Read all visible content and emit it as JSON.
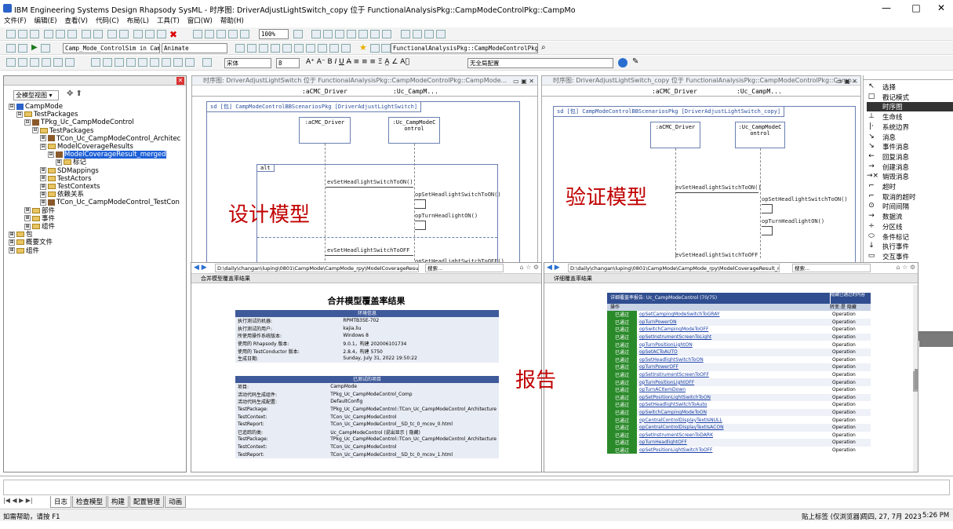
{
  "window": {
    "title": "IBM Engineering Systems Design Rhapsody SysML - 时序图: DriverAdjustLightSwitch_copy 位于 FunctionalAnalysisPkg::CampModeControlPkg::CampMo",
    "minimize": "—",
    "maximize": "□",
    "close": "✕"
  },
  "menu": [
    "文件(F)",
    "编辑(E)",
    "查看(V)",
    "代码(C)",
    "布局(L)",
    "工具(T)",
    "窗口(W)",
    "帮助(H)"
  ],
  "toolbar": {
    "zoom": "100%",
    "sim_config": "Camp_Mode_ControlSim in CampM",
    "animate": "Animate",
    "package_path": "FunctionalAnalysisPkg::CampModeControlPkg::Cam",
    "font": "宋体",
    "font_size": "8",
    "format_set": "无全局配置"
  },
  "left_panel": {
    "view_selector": "全模型视图",
    "tree": [
      {
        "level": 0,
        "expander": "⊟",
        "icon": "model",
        "label": "CampMode"
      },
      {
        "level": 1,
        "expander": "⊟",
        "icon": "folder",
        "label": "TestPackages"
      },
      {
        "level": 2,
        "expander": "⊟",
        "icon": "pkg",
        "label": "TPkg_Uc_CampModeControl"
      },
      {
        "level": 3,
        "expander": "⊟",
        "icon": "folder",
        "label": "TestPackages"
      },
      {
        "level": 4,
        "expander": "⊞",
        "icon": "pkg",
        "label": "TCon_Uc_CampModeControl_Architec"
      },
      {
        "level": 4,
        "expander": "⊟",
        "icon": "folder",
        "label": "ModelCoverageResults"
      },
      {
        "level": 5,
        "expander": "⊟",
        "icon": "pkg",
        "label": "ModelCoverageResult_merged",
        "selected": true
      },
      {
        "level": 6,
        "expander": "⊞",
        "icon": "folder",
        "label": "标记"
      },
      {
        "level": 4,
        "expander": "⊞",
        "icon": "folder",
        "label": "SDMappings"
      },
      {
        "level": 4,
        "expander": "⊞",
        "icon": "folder",
        "label": "TestActors"
      },
      {
        "level": 4,
        "expander": "⊞",
        "icon": "folder",
        "label": "TestContexts"
      },
      {
        "level": 4,
        "expander": "⊞",
        "icon": "folder",
        "label": "依赖关系"
      },
      {
        "level": 4,
        "expander": "⊞",
        "icon": "pkg",
        "label": "TCon_Uc_CampModeControl_TestCon"
      },
      {
        "level": 2,
        "expander": "⊞",
        "icon": "folder",
        "label": "部件"
      },
      {
        "level": 2,
        "expander": "⊞",
        "icon": "folder",
        "label": "事件"
      },
      {
        "level": 2,
        "expander": "⊞",
        "icon": "folder",
        "label": "组件"
      },
      {
        "level": 0,
        "expander": "⊞",
        "icon": "folder",
        "label": "包"
      },
      {
        "level": 0,
        "expander": "⊞",
        "icon": "folder",
        "label": "概要文件"
      },
      {
        "level": 0,
        "expander": "⊞",
        "icon": "folder",
        "label": "组件"
      }
    ]
  },
  "design_window": {
    "title": "时序图: DriverAdjustLightSwitch 位于 FunctionalAnalysisPkg::CampModeControlPkg::CampMode...",
    "lifeline_headers": [
      ":aCMC_Driver",
      ":Uc_CampM..."
    ],
    "frame_label": "sd [包] CampModeControlBBScenariosPkg [DriverAdjustLightSwitch]",
    "lifelines": [
      ":aCMC_Driver",
      ":Uc_CampModeC\nontrol"
    ],
    "alt_label": "alt",
    "messages": [
      "evSetHeadlightSwitchToON()",
      "opSetHeadlightSwitchToON()",
      "opTurnHeadlightON()",
      "evSetHeadlightSwitchToOFF",
      "opSetHeadlightSwitchToOFF()"
    ],
    "overlay": "设计模型"
  },
  "verify_window": {
    "title": "时序图: DriverAdjustLightSwitch_copy 位于 FunctionalAnalysisPkg::CampModeControlPkg::Camp...",
    "lifeline_headers": [
      ":aCMC_Driver",
      ":Uc_CampM..."
    ],
    "frame_label": "sd [包] CampModeControlBBScenariosPkg [DriverAdjustLightSwitch_copy]",
    "lifelines": [
      ":aCMC_Driver",
      ":Uc_CampModeC\nontrol"
    ],
    "messages": [
      "evSetHeadlightSwitchToON()",
      "opSetHeadlightSwitchToON()",
      "opTurnHeadlightON()",
      "evSetHeadlightSwitchToOFF"
    ],
    "overlay": "验证模型"
  },
  "report_overlay": "报告",
  "report_left": {
    "address": "D:\\daily\\changan\\luping\\0801\\CampMode\\CampMode_rpy\\ModelCoverageResult_merge",
    "search": "搜索...",
    "tab": "合并模型覆盖率结果",
    "heading": "合并模型覆盖率结果",
    "env_header": "环境信息",
    "env_rows": [
      [
        "执行测试的机器:",
        "RPMTB35E-702"
      ],
      [
        "执行测试的用户:",
        "kajia.liu"
      ],
      [
        "所使用操作系统版本:",
        "Windows 8"
      ],
      [
        "使用的 Rhapsody 版本:",
        "9.0.1，构建 202006101734"
      ],
      [
        "使用的 TestConductor 版本:",
        "2.8.4，构建 5750"
      ],
      [
        "生成日期:",
        "Sunday, July 31, 2022 19:50:22"
      ]
    ],
    "proj_header": "已测试的项目",
    "proj_rows": [
      [
        "项目:",
        "CampMode"
      ],
      [
        "活动代码生成组件:",
        "TPkg_Uc_CampModeControl_Comp"
      ],
      [
        "活动代码生成配置:",
        "DefaultConfig"
      ],
      [
        "TestPackage:",
        "TPkg_Uc_CampModeControl::TCon_Uc_CampModeControl_Architecture"
      ],
      [
        "TestContext:",
        "TCon_Uc_CampModeControl"
      ],
      [
        "TestReport:",
        "TCon_Uc_CampModeControl__SD_tc_0_mcov_0.html"
      ],
      [
        "已追踪的类:",
        "Uc_CampModeControl (说出显示 | 隐藏)"
      ],
      [
        "TestPackage:",
        "TPkg_Uc_CampModeControl::TCon_Uc_CampModeControl_Architecture"
      ],
      [
        "TestContext:",
        "TCon_Uc_CampModeControl"
      ],
      [
        "TestReport:",
        "TCon_Uc_CampModeControl__SD_tc_0_mcov_1.html"
      ]
    ]
  },
  "report_right": {
    "address": "D:\\daily\\changan\\luping\\0801\\CampMode\\CampMode_rpy\\ModelCoverageResult_merge",
    "search": "搜索...",
    "tab": "详细覆盖率结果",
    "header": "详细覆盖率报告: Uc_CampModeControl (70/75)",
    "hide_label": "隐藏已通过的内容",
    "col_op": "操作",
    "col_type": "转变:是 隐藏",
    "status": "已通过",
    "type": "Operation",
    "rows": [
      "opSetCampingModeSwitchToGRAY",
      "opTurnPowerON",
      "opSwitchCampingModeToOFF",
      "opSetInstrumentScreenToLight",
      "opTurnPositionLightON",
      "opSetACToAUTO",
      "opSetHeadlightSwitchToON",
      "opTurnPowerOFF",
      "opSetInstrumentScreenToOFF",
      "opTurnPositionLightOFF",
      "opTurnACItemDown",
      "opSetPositionLightSwitchToON",
      "opSetHeadlightSwitchToAuto",
      "opSwitchCampingModeToON",
      "opCentralControlDisplayTextIsNULL",
      "opCentralControlDisplayTextIsACON",
      "opSetInstrumentScreenToDARK",
      "opTurnHeadlightOFF",
      "opSetPositionLightSwitchToOFF"
    ]
  },
  "toolbox": {
    "items": [
      {
        "icon": "↖",
        "label": "选择"
      },
      {
        "icon": "□",
        "label": "戳记模式"
      },
      {
        "icon": "■",
        "label": "时序图"
      },
      {
        "icon": "⊥",
        "label": "生命线"
      },
      {
        "icon": "|·",
        "label": "系统边界"
      },
      {
        "icon": "↘",
        "label": "消息"
      },
      {
        "icon": "↘",
        "label": "事件消息"
      },
      {
        "icon": "←",
        "label": "回复消息"
      },
      {
        "icon": "→",
        "label": "创建消息"
      },
      {
        "icon": "→×",
        "label": "销毁消息"
      },
      {
        "icon": "⌐",
        "label": "超时"
      },
      {
        "icon": "⌐",
        "label": "取消的超时"
      },
      {
        "icon": "⊙",
        "label": "时间间隔"
      },
      {
        "icon": "→",
        "label": "数据流"
      },
      {
        "icon": "÷",
        "label": "分区线"
      },
      {
        "icon": "⬭",
        "label": "条件标记"
      },
      {
        "icon": "↓",
        "label": "执行事件"
      },
      {
        "icon": "▭",
        "label": "交互事件"
      }
    ]
  },
  "bottom_tabs": [
    "日志",
    "检查模型",
    "构建",
    "配置管理",
    "动画"
  ],
  "status": {
    "help": "如需帮助，请按 F1",
    "mode": "贴上标签 (仅浏览器)",
    "date": "周四, 27, 7月 2023",
    "time": "5:26 PM"
  }
}
